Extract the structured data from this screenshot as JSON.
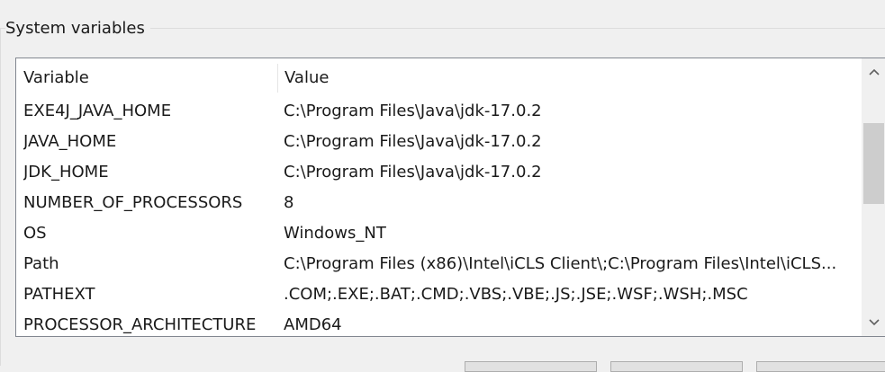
{
  "group": {
    "title": "System variables"
  },
  "table": {
    "columns": [
      "Variable",
      "Value"
    ],
    "rows": [
      {
        "variable": "EXE4J_JAVA_HOME",
        "value": "C:\\Program Files\\Java\\jdk-17.0.2"
      },
      {
        "variable": "JAVA_HOME",
        "value": "C:\\Program Files\\Java\\jdk-17.0.2"
      },
      {
        "variable": "JDK_HOME",
        "value": "C:\\Program Files\\Java\\jdk-17.0.2"
      },
      {
        "variable": "NUMBER_OF_PROCESSORS",
        "value": "8"
      },
      {
        "variable": "OS",
        "value": "Windows_NT"
      },
      {
        "variable": "Path",
        "value": "C:\\Program Files (x86)\\Intel\\iCLS Client\\;C:\\Program Files\\Intel\\iCLS..."
      },
      {
        "variable": "PATHEXT",
        "value": ".COM;.EXE;.BAT;.CMD;.VBS;.VBE;.JS;.JSE;.WSF;.WSH;.MSC"
      },
      {
        "variable": "PROCESSOR_ARCHITECTURE",
        "value": "AMD64"
      }
    ]
  },
  "icons": {
    "scroll_up": "chevron-up-icon",
    "scroll_down": "chevron-down-icon"
  },
  "colors": {
    "window_bg": "#f0f0f0",
    "list_bg": "#ffffff",
    "list_border": "#828790",
    "scroll_thumb": "#cdcdcd"
  }
}
